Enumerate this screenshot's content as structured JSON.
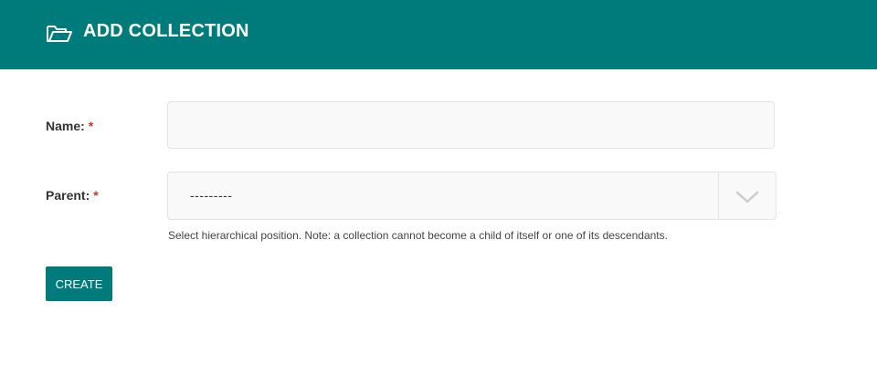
{
  "header": {
    "icon": "folder-open-icon",
    "title": "ADD COLLECTION",
    "background_color": "#007b7b"
  },
  "form": {
    "name_field": {
      "label": "Name:",
      "required_marker": "*",
      "value": "",
      "placeholder": ""
    },
    "parent_field": {
      "label": "Parent:",
      "required_marker": "*",
      "selected_value": "---------",
      "dropdown_icon": "chevron-down-icon",
      "help_text": "Select hierarchical position. Note: a collection cannot become a child of itself or one of its descendants."
    },
    "submit_label": "CREATE"
  },
  "colors": {
    "accent": "#007b7b",
    "required": "#c0392b"
  }
}
